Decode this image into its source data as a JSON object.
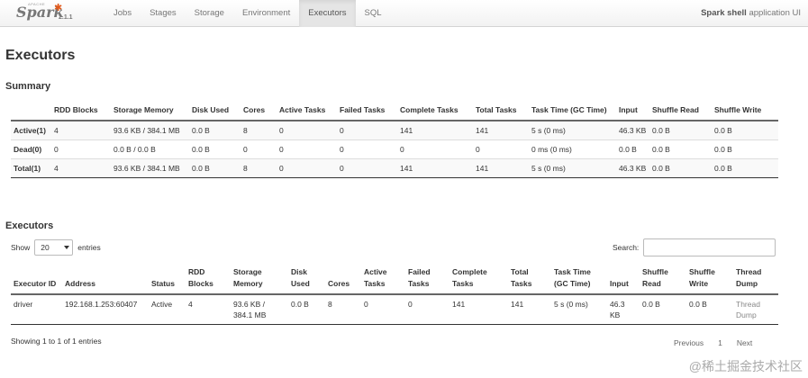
{
  "brand": {
    "apache": "APACHE",
    "name": "Spark",
    "version": "2.1.1"
  },
  "nav": {
    "tabs": [
      {
        "label": "Jobs"
      },
      {
        "label": "Stages"
      },
      {
        "label": "Storage"
      },
      {
        "label": "Environment"
      },
      {
        "label": "Executors"
      },
      {
        "label": "SQL"
      }
    ],
    "active": "Executors",
    "app_name": "Spark shell",
    "app_suffix": "application UI"
  },
  "page_title": "Executors",
  "summary": {
    "heading": "Summary",
    "headers": [
      "",
      "RDD Blocks",
      "Storage Memory",
      "Disk Used",
      "Cores",
      "Active Tasks",
      "Failed Tasks",
      "Complete Tasks",
      "Total Tasks",
      "Task Time (GC Time)",
      "Input",
      "Shuffle Read",
      "Shuffle Write"
    ],
    "rows": [
      [
        "Active(1)",
        "4",
        "93.6 KB / 384.1 MB",
        "0.0 B",
        "8",
        "0",
        "0",
        "141",
        "141",
        "5 s (0 ms)",
        "46.3 KB",
        "0.0 B",
        "0.0 B"
      ],
      [
        "Dead(0)",
        "0",
        "0.0 B / 0.0 B",
        "0.0 B",
        "0",
        "0",
        "0",
        "0",
        "0",
        "0 ms (0 ms)",
        "0.0 B",
        "0.0 B",
        "0.0 B"
      ],
      [
        "Total(1)",
        "4",
        "93.6 KB / 384.1 MB",
        "0.0 B",
        "8",
        "0",
        "0",
        "141",
        "141",
        "5 s (0 ms)",
        "46.3 KB",
        "0.0 B",
        "0.0 B"
      ]
    ]
  },
  "executors": {
    "heading": "Executors",
    "show_label": "Show",
    "page_size": "20",
    "entries_label": "entries",
    "search_label": "Search:",
    "search_value": "",
    "headers": [
      "Executor ID",
      "Address",
      "Status",
      "RDD Blocks",
      "Storage Memory",
      "Disk Used",
      "Cores",
      "Active Tasks",
      "Failed Tasks",
      "Complete Tasks",
      "Total Tasks",
      "Task Time (GC Time)",
      "Input",
      "Shuffle Read",
      "Shuffle Write",
      "Thread Dump"
    ],
    "rows": [
      [
        "driver",
        "192.168.1.253:60407",
        "Active",
        "4",
        "93.6 KB / 384.1 MB",
        "0.0 B",
        "8",
        "0",
        "0",
        "141",
        "141",
        "5 s (0 ms)",
        "46.3 KB",
        "0.0 B",
        "0.0 B",
        "Thread Dump"
      ]
    ],
    "info": "Showing 1 to 1 of 1 entries",
    "pager": {
      "previous": "Previous",
      "page": "1",
      "next": "Next"
    }
  },
  "watermark": "@稀土掘金技术社区"
}
